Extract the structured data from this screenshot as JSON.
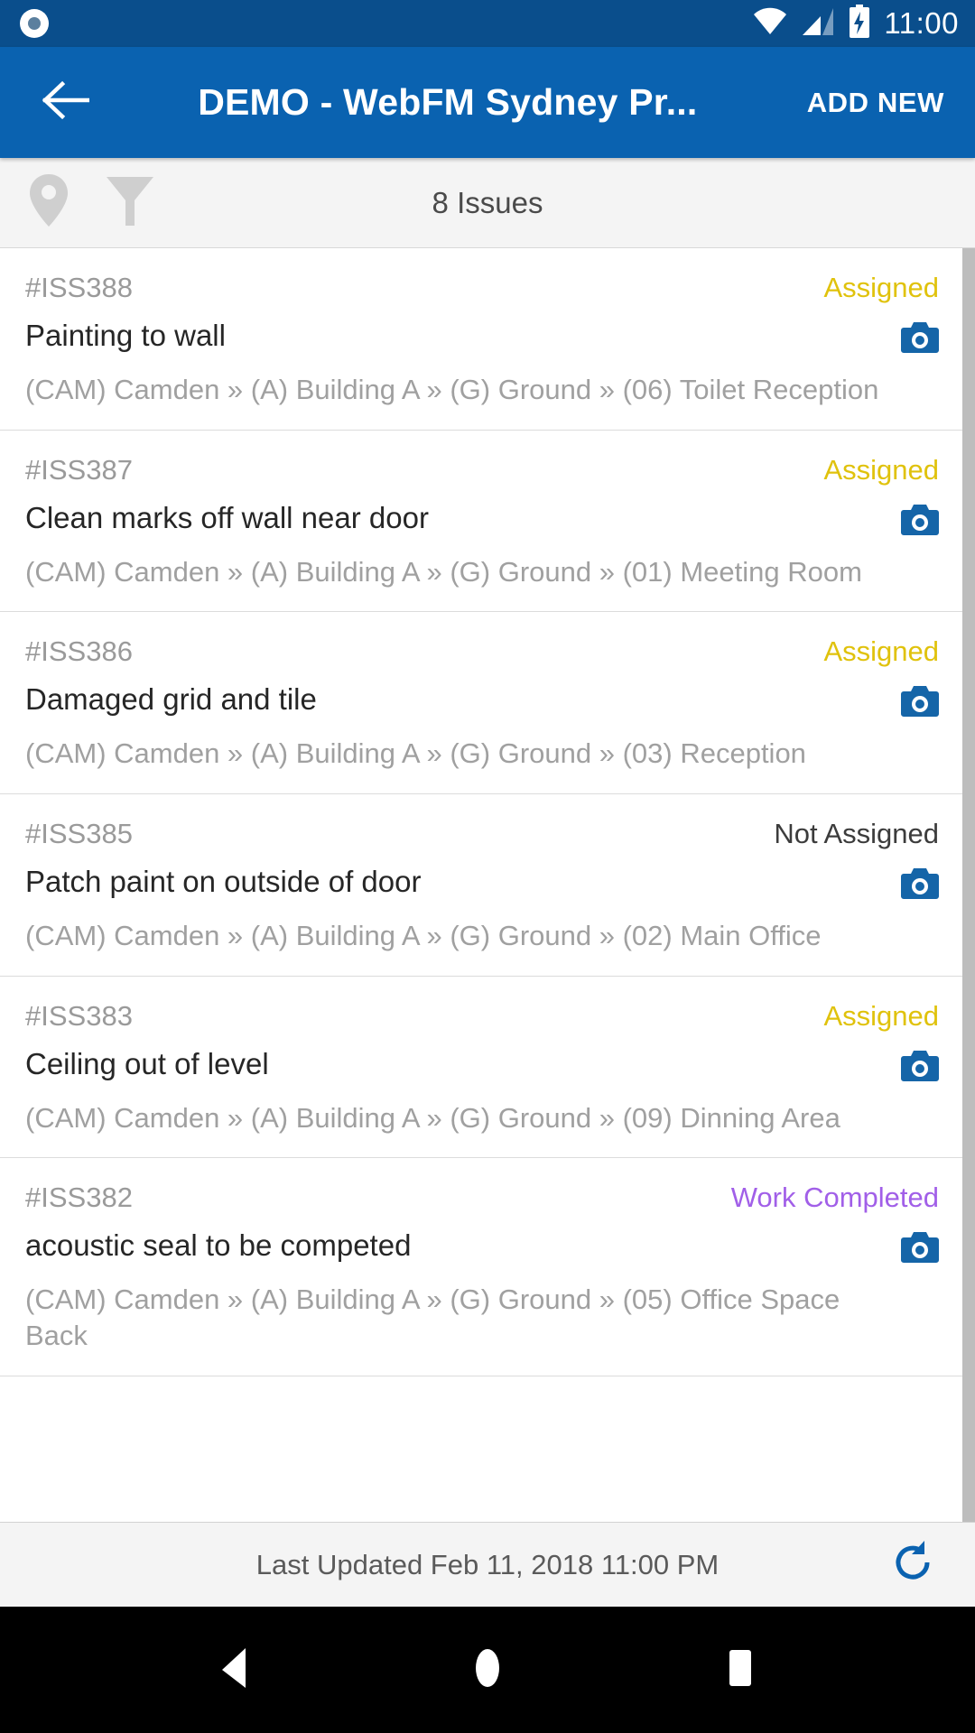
{
  "status_bar": {
    "left_icon": "record-circle-icon",
    "wifi_icon": "wifi-icon",
    "signal_icon": "cell-signal-icon",
    "battery_icon": "battery-charging-icon",
    "time": "11:00"
  },
  "app_bar": {
    "back_icon": "back-arrow-icon",
    "title": "DEMO - WebFM Sydney Pr...",
    "action_label": "ADD NEW"
  },
  "filter_bar": {
    "map_icon": "map-pin-icon",
    "filter_icon": "funnel-filter-icon",
    "count_label": "8 Issues"
  },
  "issues": [
    {
      "id": "#ISS388",
      "status": "Assigned",
      "status_kind": "assigned",
      "title": "Painting to wall",
      "location": "(CAM) Camden » (A) Building A » (G) Ground  » (06) Toilet Reception",
      "camera_icon": "camera-icon"
    },
    {
      "id": "#ISS387",
      "status": "Assigned",
      "status_kind": "assigned",
      "title": "Clean marks off wall near door",
      "location": "(CAM) Camden » (A) Building A » (G) Ground  » (01) Meeting Room",
      "camera_icon": "camera-icon"
    },
    {
      "id": "#ISS386",
      "status": "Assigned",
      "status_kind": "assigned",
      "title": "Damaged grid and tile",
      "location": "(CAM) Camden » (A) Building A » (G) Ground  » (03) Reception",
      "camera_icon": "camera-icon"
    },
    {
      "id": "#ISS385",
      "status": "Not Assigned",
      "status_kind": "notassigned",
      "title": "Patch paint on outside of door",
      "location": "(CAM) Camden » (A) Building A » (G) Ground  » (02) Main Office",
      "camera_icon": "camera-icon"
    },
    {
      "id": "#ISS383",
      "status": "Assigned",
      "status_kind": "assigned",
      "title": "Ceiling out of level",
      "location": "(CAM) Camden » (A) Building A » (G) Ground  » (09) Dinning Area",
      "camera_icon": "camera-icon"
    },
    {
      "id": "#ISS382",
      "status": "Work Completed",
      "status_kind": "completed",
      "title": "acoustic seal to be competed",
      "location": "(CAM) Camden » (A) Building A » (G) Ground  » (05) Office Space Back",
      "camera_icon": "camera-icon"
    }
  ],
  "footer": {
    "last_updated": "Last Updated Feb 11, 2018 11:00 PM",
    "refresh_icon": "refresh-icon"
  },
  "nav_bar": {
    "back_icon": "nav-back-triangle-icon",
    "home_icon": "nav-home-circle-icon",
    "recents_icon": "nav-recents-square-icon"
  },
  "colors": {
    "status_bar_bg": "#0a4e8c",
    "app_bar_bg": "#0a62b0",
    "accent_blue": "#1565a8",
    "status_assigned": "#e0c20c",
    "status_not_assigned": "#3c3c3c",
    "status_completed": "#a15fe8",
    "toolbar_bg": "#f4f4f4",
    "muted_text": "#a0a0a0"
  }
}
